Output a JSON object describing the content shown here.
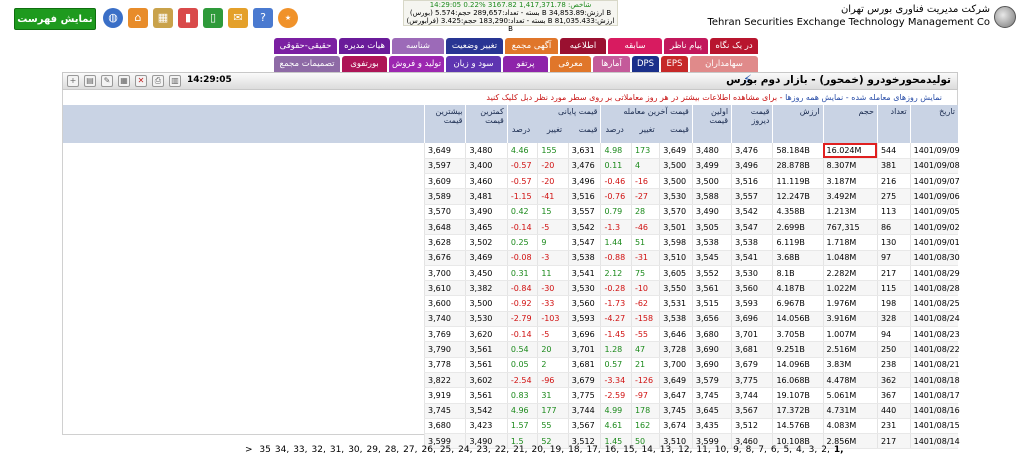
{
  "header": {
    "company_fa": "شرکت مدیریت فناوری بورس تهران",
    "company_en": "Tehran Securities Exchange Technology Management Co",
    "show_list_button": "نمایش فهرست",
    "ticker": {
      "line1": "شاخص: 1,417,371.78 3167.82 %0.22 14:29:05",
      "line2": "(بورس) بسته - تعداد:289,657 حجم:5.574 B ارزش:34,853.89 B",
      "line3": "(فرابورس) بسته - تعداد:183,290 حجم:3.425 B ارزش:81,035.433 B"
    }
  },
  "menu": {
    "row1": [
      "در یک نگاه",
      "پیام ناظر",
      "سابقه",
      "اطلاعیه",
      "آگهی مجمع",
      "تغییر وضعیت",
      "شناسه",
      "هیات مدیره",
      "حقیقی-حقوقی"
    ],
    "row2": [
      "سهامداران",
      "EPS",
      "DPS",
      "آمارها",
      "معرفی",
      "پرتفو",
      "سود و زیان",
      "تولید و فروش",
      "بورتفوی",
      "تصمیمات مجمع"
    ]
  },
  "titlebar": {
    "title": "تولیدمحورخودرو (خمحور) - بازار دوم بورس",
    "time": "14:29:05"
  },
  "info": {
    "part1": "نمایش روزهای معامله شده",
    "sep": " - ",
    "part2": "نمایش همه روزها",
    "part3": " - برای مشاهده اطلاعات بیشتر در هر روز معاملاتی بر روی سطر مورد نظر دبل کلیک کنید"
  },
  "columns": {
    "date": "تاریخ",
    "count": "تعداد",
    "volume": "حجم",
    "value": "ارزش",
    "yesterday": "قیمت دیروز",
    "first": "اولین قیمت",
    "last_group": "قیمت آخرین معامله",
    "close_group": "قیمت پایانی",
    "price": "قیمت",
    "change": "تغییر",
    "pct": "درصد",
    "min": "کمترین قیمت",
    "max": "بیشترین قیمت"
  },
  "rows": [
    {
      "date": "1401/09/09",
      "count": "544",
      "volume": "16.024M",
      "value": "58.184B",
      "yesterday": "3,476",
      "first": "3,480",
      "last": "3,649",
      "last_chg": "173",
      "last_pct": "4.98",
      "close": "3,631",
      "close_chg": "155",
      "close_pct": "4.46",
      "min": "3,480",
      "max": "3,649"
    },
    {
      "date": "1401/09/08",
      "count": "381",
      "volume": "8.307M",
      "value": "28.878B",
      "yesterday": "3,496",
      "first": "3,499",
      "last": "3,500",
      "last_chg": "4",
      "last_pct": "0.11",
      "close": "3,476",
      "close_chg": "-20",
      "close_pct": "-0.57",
      "min": "3,400",
      "max": "3,597"
    },
    {
      "date": "1401/09/07",
      "count": "216",
      "volume": "3.187M",
      "value": "11.119B",
      "yesterday": "3,516",
      "first": "3,500",
      "last": "3,500",
      "last_chg": "-16",
      "last_pct": "-0.46",
      "close": "3,496",
      "close_chg": "-20",
      "close_pct": "-0.57",
      "min": "3,460",
      "max": "3,609"
    },
    {
      "date": "1401/09/06",
      "count": "275",
      "volume": "3.492M",
      "value": "12.247B",
      "yesterday": "3,557",
      "first": "3,588",
      "last": "3,530",
      "last_chg": "-27",
      "last_pct": "-0.76",
      "close": "3,516",
      "close_chg": "-41",
      "close_pct": "-1.15",
      "min": "3,481",
      "max": "3,589"
    },
    {
      "date": "1401/09/05",
      "count": "113",
      "volume": "1.213M",
      "value": "4.358B",
      "yesterday": "3,542",
      "first": "3,490",
      "last": "3,570",
      "last_chg": "28",
      "last_pct": "0.79",
      "close": "3,557",
      "close_chg": "15",
      "close_pct": "0.42",
      "min": "3,490",
      "max": "3,570"
    },
    {
      "date": "1401/09/02",
      "count": "86",
      "volume": "767,315",
      "value": "2.699B",
      "yesterday": "3,547",
      "first": "3,505",
      "last": "3,501",
      "last_chg": "-46",
      "last_pct": "-1.3",
      "close": "3,542",
      "close_chg": "-5",
      "close_pct": "-0.14",
      "min": "3,465",
      "max": "3,648"
    },
    {
      "date": "1401/09/01",
      "count": "130",
      "volume": "1.718M",
      "value": "6.119B",
      "yesterday": "3,538",
      "first": "3,538",
      "last": "3,598",
      "last_chg": "51",
      "last_pct": "1.44",
      "close": "3,547",
      "close_chg": "9",
      "close_pct": "0.25",
      "min": "3,502",
      "max": "3,628"
    },
    {
      "date": "1401/08/30",
      "count": "97",
      "volume": "1.048M",
      "value": "3.68B",
      "yesterday": "3,541",
      "first": "3,545",
      "last": "3,510",
      "last_chg": "-31",
      "last_pct": "-0.88",
      "close": "3,538",
      "close_chg": "-3",
      "close_pct": "-0.08",
      "min": "3,469",
      "max": "3,676"
    },
    {
      "date": "1401/08/29",
      "count": "217",
      "volume": "2.282M",
      "value": "8.1B",
      "yesterday": "3,530",
      "first": "3,552",
      "last": "3,605",
      "last_chg": "75",
      "last_pct": "2.12",
      "close": "3,541",
      "close_chg": "11",
      "close_pct": "0.31",
      "min": "3,450",
      "max": "3,700"
    },
    {
      "date": "1401/08/28",
      "count": "115",
      "volume": "1.022M",
      "value": "4.187B",
      "yesterday": "3,560",
      "first": "3,561",
      "last": "3,550",
      "last_chg": "-10",
      "last_pct": "-0.28",
      "close": "3,530",
      "close_chg": "-30",
      "close_pct": "-0.84",
      "min": "3,382",
      "max": "3,610"
    },
    {
      "date": "1401/08/25",
      "count": "198",
      "volume": "1.976M",
      "value": "6.967B",
      "yesterday": "3,593",
      "first": "3,515",
      "last": "3,531",
      "last_chg": "-62",
      "last_pct": "-1.73",
      "close": "3,560",
      "close_chg": "-33",
      "close_pct": "-0.92",
      "min": "3,500",
      "max": "3,600"
    },
    {
      "date": "1401/08/24",
      "count": "328",
      "volume": "3.916M",
      "value": "14.056B",
      "yesterday": "3,696",
      "first": "3,656",
      "last": "3,538",
      "last_chg": "-158",
      "last_pct": "-4.27",
      "close": "3,593",
      "close_chg": "-103",
      "close_pct": "-2.79",
      "min": "3,530",
      "max": "3,740"
    },
    {
      "date": "1401/08/23",
      "count": "94",
      "volume": "1.007M",
      "value": "3.705B",
      "yesterday": "3,701",
      "first": "3,680",
      "last": "3,646",
      "last_chg": "-55",
      "last_pct": "-1.45",
      "close": "3,696",
      "close_chg": "-5",
      "close_pct": "-0.14",
      "min": "3,620",
      "max": "3,769"
    },
    {
      "date": "1401/08/22",
      "count": "250",
      "volume": "2.516M",
      "value": "9.251B",
      "yesterday": "3,681",
      "first": "3,690",
      "last": "3,728",
      "last_chg": "47",
      "last_pct": "1.28",
      "close": "3,701",
      "close_chg": "20",
      "close_pct": "0.54",
      "min": "3,561",
      "max": "3,790"
    },
    {
      "date": "1401/08/21",
      "count": "238",
      "volume": "3.83M",
      "value": "14.096B",
      "yesterday": "3,679",
      "first": "3,690",
      "last": "3,700",
      "last_chg": "21",
      "last_pct": "0.57",
      "close": "3,681",
      "close_chg": "2",
      "close_pct": "0.05",
      "min": "3,561",
      "max": "3,778"
    },
    {
      "date": "1401/08/18",
      "count": "362",
      "volume": "4.478M",
      "value": "16.068B",
      "yesterday": "3,775",
      "first": "3,579",
      "last": "3,649",
      "last_chg": "-126",
      "last_pct": "-3.34",
      "close": "3,679",
      "close_chg": "-96",
      "close_pct": "-2.54",
      "min": "3,602",
      "max": "3,822"
    },
    {
      "date": "1401/08/17",
      "count": "367",
      "volume": "5.061M",
      "value": "19.107B",
      "yesterday": "3,744",
      "first": "3,745",
      "last": "3,647",
      "last_chg": "-97",
      "last_pct": "-2.59",
      "close": "3,775",
      "close_chg": "31",
      "close_pct": "0.83",
      "min": "3,561",
      "max": "3,919"
    },
    {
      "date": "1401/08/16",
      "count": "440",
      "volume": "4.731M",
      "value": "17.372B",
      "yesterday": "3,567",
      "first": "3,645",
      "last": "3,745",
      "last_chg": "178",
      "last_pct": "4.99",
      "close": "3,744",
      "close_chg": "177",
      "close_pct": "4.96",
      "min": "3,542",
      "max": "3,745"
    },
    {
      "date": "1401/08/15",
      "count": "231",
      "volume": "4.083M",
      "value": "14.576B",
      "yesterday": "3,512",
      "first": "3,435",
      "last": "3,674",
      "last_chg": "162",
      "last_pct": "4.61",
      "close": "3,567",
      "close_chg": "55",
      "close_pct": "1.57",
      "min": "3,423",
      "max": "3,680"
    },
    {
      "date": "1401/08/14",
      "count": "217",
      "volume": "2.856M",
      "value": "10.108B",
      "yesterday": "3,460",
      "first": "3,599",
      "last": "3,510",
      "last_chg": "50",
      "last_pct": "1.45",
      "close": "3,512",
      "close_chg": "52",
      "close_pct": "1.5",
      "min": "3,490",
      "max": "3,599"
    }
  ],
  "pager": {
    "pages": [
      "1,",
      "2,",
      "3,",
      "4,",
      "5,",
      "6,",
      "7,",
      "8,",
      "9,",
      "10,",
      "11,",
      "12,",
      "13,",
      "14,",
      "15,",
      "16,",
      "17,",
      "18,",
      "19,",
      "20,",
      "21,",
      "22,",
      "23,",
      "24,",
      "25,",
      "26,",
      "27,",
      "28,",
      "29,",
      "30,",
      "31,",
      "32,",
      "33,",
      "34,",
      "35"
    ],
    "next": ">"
  },
  "colors": {
    "positive": "#1c8a1c",
    "negative": "#d01010",
    "header_bg": "#c9d3e4",
    "highlight_border": "#e02020"
  }
}
